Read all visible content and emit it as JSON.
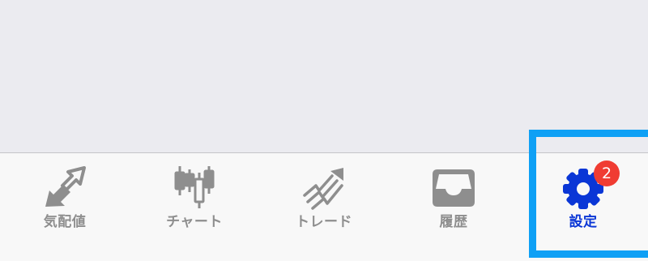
{
  "tabbar": {
    "tabs": [
      {
        "id": "rates",
        "label": "気配値",
        "icon": "rates-arrows-icon"
      },
      {
        "id": "chart",
        "label": "チャート",
        "icon": "candlestick-icon"
      },
      {
        "id": "trade",
        "label": "トレード",
        "icon": "trend-arrow-icon"
      },
      {
        "id": "history",
        "label": "履歴",
        "icon": "inbox-tray-icon"
      },
      {
        "id": "settings",
        "label": "設定",
        "icon": "gear-icon",
        "active": true,
        "badge": "2"
      }
    ]
  },
  "colors": {
    "inactive": "#8e8e8e",
    "active": "#0a36d6",
    "badge": "#f03c32",
    "highlight": "#0fa0f5",
    "content_bg": "#ebebf0",
    "tabbar_bg": "#f8f8f8"
  }
}
